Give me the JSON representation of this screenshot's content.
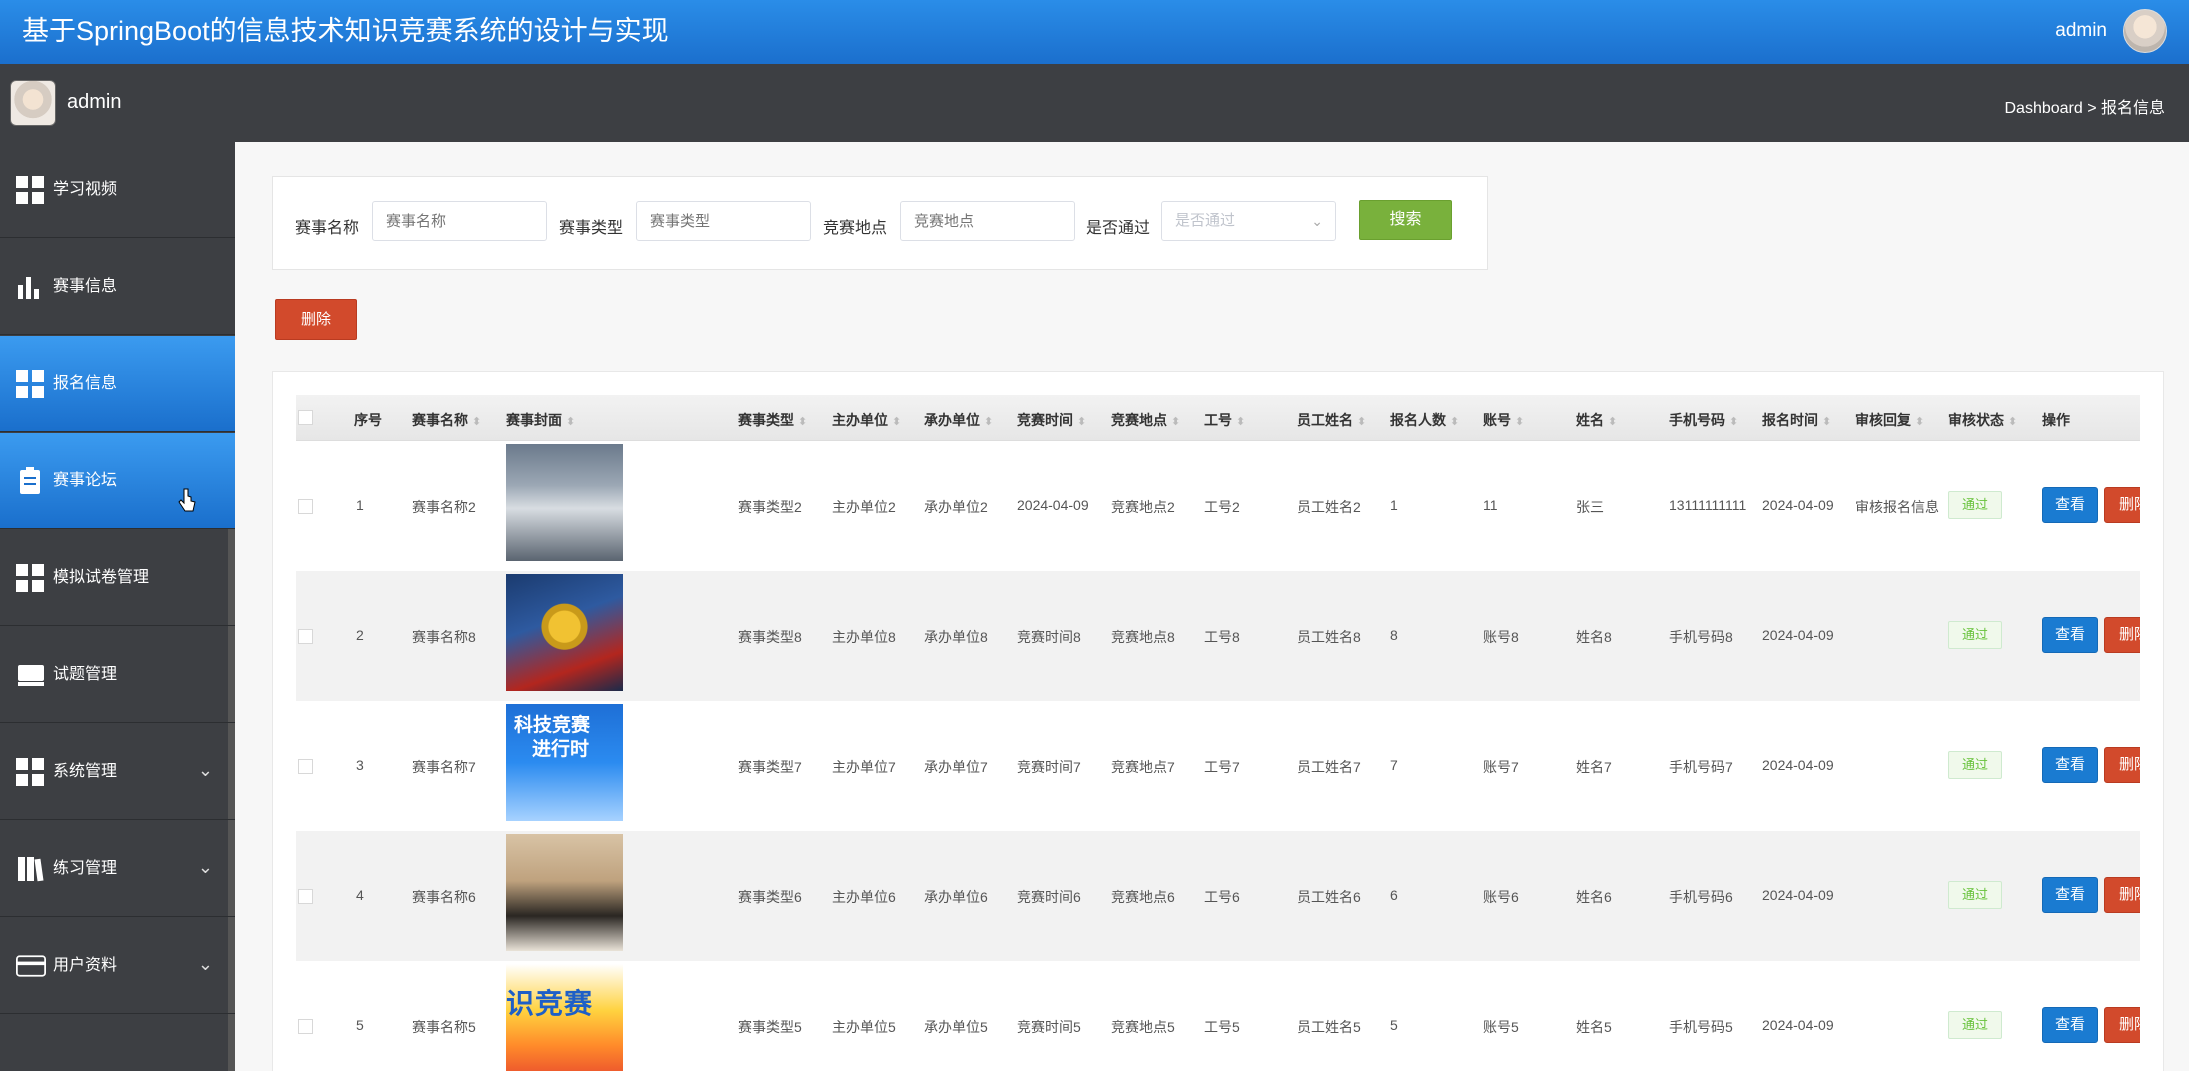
{
  "app": {
    "title": "基于SpringBoot的信息技术知识竞赛系统的设计与实现",
    "user": "admin"
  },
  "subbar": {
    "name": "admin",
    "breadcrumb": "Dashboard > 报名信息"
  },
  "sidebar": {
    "items": [
      {
        "label": "学习视频",
        "icon": "grid-icon",
        "active": false
      },
      {
        "label": "赛事信息",
        "icon": "bar-chart-icon",
        "active": false
      },
      {
        "label": "报名信息",
        "icon": "grid-icon",
        "active": true
      },
      {
        "label": "赛事论坛",
        "icon": "clipboard-icon",
        "active": true
      },
      {
        "label": "模拟试卷管理",
        "icon": "grid-icon",
        "active": false
      },
      {
        "label": "试题管理",
        "icon": "monitor-icon",
        "active": false
      },
      {
        "label": "系统管理",
        "icon": "grid-icon",
        "active": false,
        "expandable": true
      },
      {
        "label": "练习管理",
        "icon": "book-icon",
        "active": false,
        "expandable": true
      },
      {
        "label": "用户资料",
        "icon": "card-icon",
        "active": false,
        "expandable": true
      }
    ]
  },
  "search": {
    "name_label": "赛事名称",
    "name_placeholder": "赛事名称",
    "type_label": "赛事类型",
    "type_placeholder": "赛事类型",
    "place_label": "竞赛地点",
    "place_placeholder": "竞赛地点",
    "pass_label": "是否通过",
    "pass_placeholder": "是否通过",
    "search_button": "搜索"
  },
  "delete_button": "删除",
  "table": {
    "headers": [
      "序号",
      "赛事名称",
      "赛事封面",
      "赛事类型",
      "主办单位",
      "承办单位",
      "竞赛时间",
      "竞赛地点",
      "工号",
      "员工姓名",
      "报名人数",
      "账号",
      "姓名",
      "手机号码",
      "报名时间",
      "审核回复",
      "审核状态",
      "操作"
    ],
    "rows": [
      {
        "no": "1",
        "name": "赛事名称2",
        "type": "赛事类型2",
        "host": "主办单位2",
        "org": "承办单位2",
        "time": "2024-04-09",
        "place": "竞赛地点2",
        "emp_no": "工号2",
        "emp_name": "员工姓名2",
        "count": "1",
        "account": "11",
        "real_name": "张三",
        "phone": "13111111111",
        "reg_time": "2024-04-09",
        "reply": "审核报名信息",
        "status": "通过",
        "view": "查看",
        "remove": "删除"
      },
      {
        "no": "2",
        "name": "赛事名称8",
        "type": "赛事类型8",
        "host": "主办单位8",
        "org": "承办单位8",
        "time": "竞赛时间8",
        "place": "竞赛地点8",
        "emp_no": "工号8",
        "emp_name": "员工姓名8",
        "count": "8",
        "account": "账号8",
        "real_name": "姓名8",
        "phone": "手机号码8",
        "reg_time": "2024-04-09",
        "reply": "",
        "status": "通过",
        "view": "查看",
        "remove": "删除"
      },
      {
        "no": "3",
        "name": "赛事名称7",
        "type": "赛事类型7",
        "host": "主办单位7",
        "org": "承办单位7",
        "time": "竞赛时间7",
        "place": "竞赛地点7",
        "emp_no": "工号7",
        "emp_name": "员工姓名7",
        "count": "7",
        "account": "账号7",
        "real_name": "姓名7",
        "phone": "手机号码7",
        "reg_time": "2024-04-09",
        "reply": "",
        "status": "通过",
        "view": "查看",
        "remove": "删除",
        "cover_text": [
          "科技竞赛",
          "进行时"
        ]
      },
      {
        "no": "4",
        "name": "赛事名称6",
        "type": "赛事类型6",
        "host": "主办单位6",
        "org": "承办单位6",
        "time": "竞赛时间6",
        "place": "竞赛地点6",
        "emp_no": "工号6",
        "emp_name": "员工姓名6",
        "count": "6",
        "account": "账号6",
        "real_name": "姓名6",
        "phone": "手机号码6",
        "reg_time": "2024-04-09",
        "reply": "",
        "status": "通过",
        "view": "查看",
        "remove": "删除"
      },
      {
        "no": "5",
        "name": "赛事名称5",
        "type": "赛事类型5",
        "host": "主办单位5",
        "org": "承办单位5",
        "time": "竞赛时间5",
        "place": "竞赛地点5",
        "emp_no": "工号5",
        "emp_name": "员工姓名5",
        "count": "5",
        "account": "账号5",
        "real_name": "姓名5",
        "phone": "手机号码5",
        "reg_time": "2024-04-09",
        "reply": "",
        "status": "通过",
        "view": "查看",
        "remove": "删除",
        "cover_text": [
          "识竞赛"
        ]
      }
    ]
  },
  "colors": {
    "topbar": "#1b6fcd",
    "sidebar": "#3d3f43",
    "active": "#2a8de8",
    "search_button": "#79b13c",
    "delete_button": "#d24a2c",
    "view_button": "#1a7bd1",
    "status_green": "#67c23a"
  }
}
